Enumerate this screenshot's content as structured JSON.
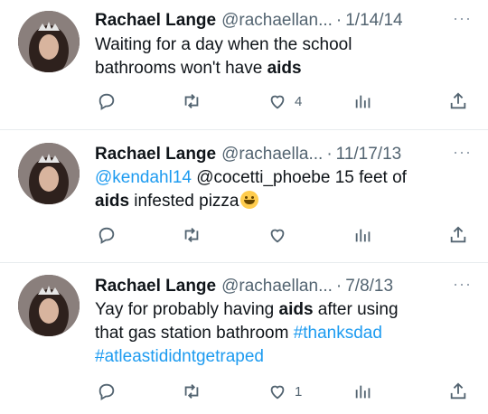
{
  "tweets": [
    {
      "name": "Rachael Lange",
      "handle": "@rachaellan...",
      "dot": "·",
      "date": "1/14/14",
      "more": "···",
      "text_before": "Waiting for a day when the school\nbathrooms won't have ",
      "text_bold": "aids",
      "text_after": "",
      "like_count": "4"
    },
    {
      "name": "Rachael Lange",
      "handle": "@rachaella...",
      "dot": "·",
      "date": "11/17/13",
      "more": "···",
      "mention": "@kendahl14",
      "text_mid": " @cocetti_phoebe 15 feet of\n",
      "text_bold": "aids",
      "text_after": " infested pizza",
      "emoji": "grinning-face-emoji",
      "like_count": ""
    },
    {
      "name": "Rachael Lange",
      "handle": "@rachaellan...",
      "dot": "·",
      "date": "7/8/13",
      "more": "···",
      "text_before": "Yay for probably having ",
      "text_bold": "aids",
      "text_after": " after using\nthat gas station bathroom ",
      "hashtag1": "#thanksdad",
      "hashtag2": "#atleastididntgetraped",
      "like_count": "1"
    }
  ],
  "icons": [
    "reply-icon",
    "retweet-icon",
    "like-icon",
    "views-icon",
    "share-icon"
  ],
  "colors": {
    "link": "#1d9bf0",
    "secondary": "#536471",
    "text": "#0f1419"
  }
}
